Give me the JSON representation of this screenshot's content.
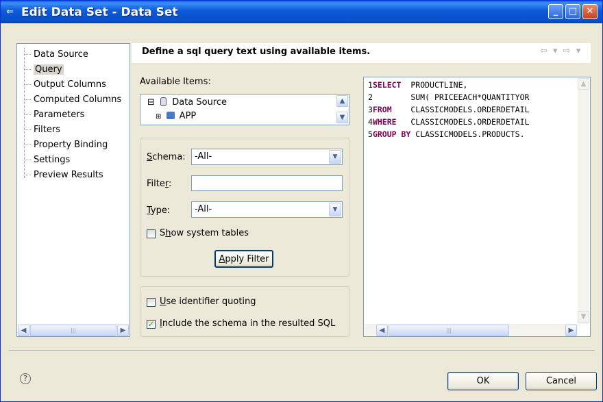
{
  "window": {
    "title": "Edit Data Set - Data Set",
    "min_glyph": "_",
    "max_glyph": "□",
    "close_glyph": "✕"
  },
  "nav": {
    "items": [
      {
        "label": "Data Source"
      },
      {
        "label": "Query",
        "selected": true
      },
      {
        "label": "Output Columns"
      },
      {
        "label": "Computed Columns"
      },
      {
        "label": "Parameters"
      },
      {
        "label": "Filters"
      },
      {
        "label": "Property Binding"
      },
      {
        "label": "Settings"
      },
      {
        "label": "Preview Results"
      }
    ]
  },
  "header": {
    "title": "Define a sql query text using available items.",
    "back_glyph": "⇦ ▾",
    "forward_glyph": "⇨ ▾"
  },
  "available": {
    "label": "Available Items:",
    "tree": [
      {
        "expander": "⊟",
        "label": "Data Source"
      },
      {
        "expander": "⊞",
        "label": "APP"
      }
    ]
  },
  "filter_group": {
    "schema_label_u": "S",
    "schema_label_rest": "chema:",
    "schema_value": "-All-",
    "filter_label_start": "Filte",
    "filter_label_u": "r",
    "filter_label_end": ":",
    "filter_value": "",
    "type_label_u": "T",
    "type_label_rest": "ype:",
    "type_value": "-All-",
    "show_system_start": "S",
    "show_system_u": "h",
    "show_system_end": "ow system tables",
    "show_system_checked": false,
    "apply_u": "A",
    "apply_rest": "pply Filter"
  },
  "options_group": {
    "quoting_u": "U",
    "quoting_rest": "se identifier quoting",
    "quoting_checked": false,
    "schema_u": "I",
    "schema_rest": "nclude the schema in the resulted SQL",
    "schema_checked": true
  },
  "sql": {
    "lines": [
      {
        "num": "1",
        "kw": "SELECT",
        "pad": "  ",
        "text": "PRODUCTLINE,"
      },
      {
        "num": "2",
        "kw": "",
        "pad": "        ",
        "text": "SUM( PRICEEACH*QUANTITYOR"
      },
      {
        "num": "3",
        "kw": "FROM",
        "pad": "    ",
        "text": "CLASSICMODELS.ORDERDETAIL"
      },
      {
        "num": "4",
        "kw": "WHERE",
        "pad": "   ",
        "text": "CLASSICMODELS.ORDERDETAIL"
      },
      {
        "num": "5",
        "kw": "GROUP BY",
        "pad": " ",
        "text": "CLASSICMODELS.PRODUCTS."
      }
    ]
  },
  "footer": {
    "help_glyph": "?",
    "ok_label": "OK",
    "cancel_label": "Cancel"
  }
}
